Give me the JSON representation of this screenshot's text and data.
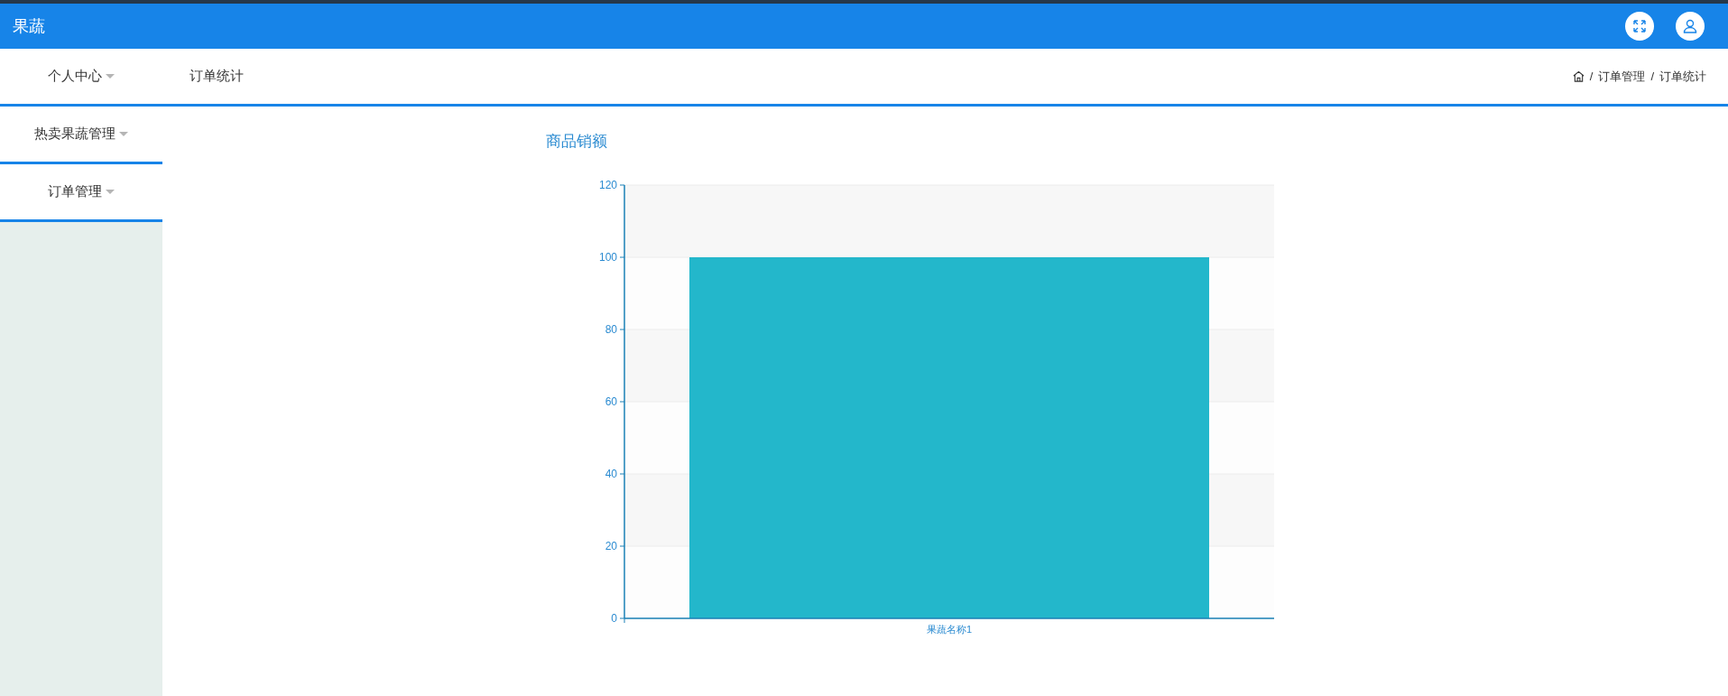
{
  "header": {
    "title": "果蔬"
  },
  "top_nav": [
    {
      "label": "个人中心",
      "dropdown": true
    },
    {
      "label": "订单统计",
      "dropdown": false
    }
  ],
  "breadcrumb": {
    "separator": "/",
    "items": [
      "订单管理",
      "订单统计"
    ]
  },
  "sidebar": {
    "items": [
      {
        "label": "热卖果蔬管理",
        "dropdown": true
      },
      {
        "label": "订单管理",
        "dropdown": true
      }
    ]
  },
  "chart": {
    "chart_data": {
      "type": "bar",
      "title": "商品销额",
      "categories": [
        "果蔬名称1"
      ],
      "values": [
        100
      ],
      "grid": true,
      "ylim": [
        0,
        120
      ],
      "yticks": [
        0,
        20,
        40,
        60,
        80,
        100,
        120
      ]
    }
  }
}
